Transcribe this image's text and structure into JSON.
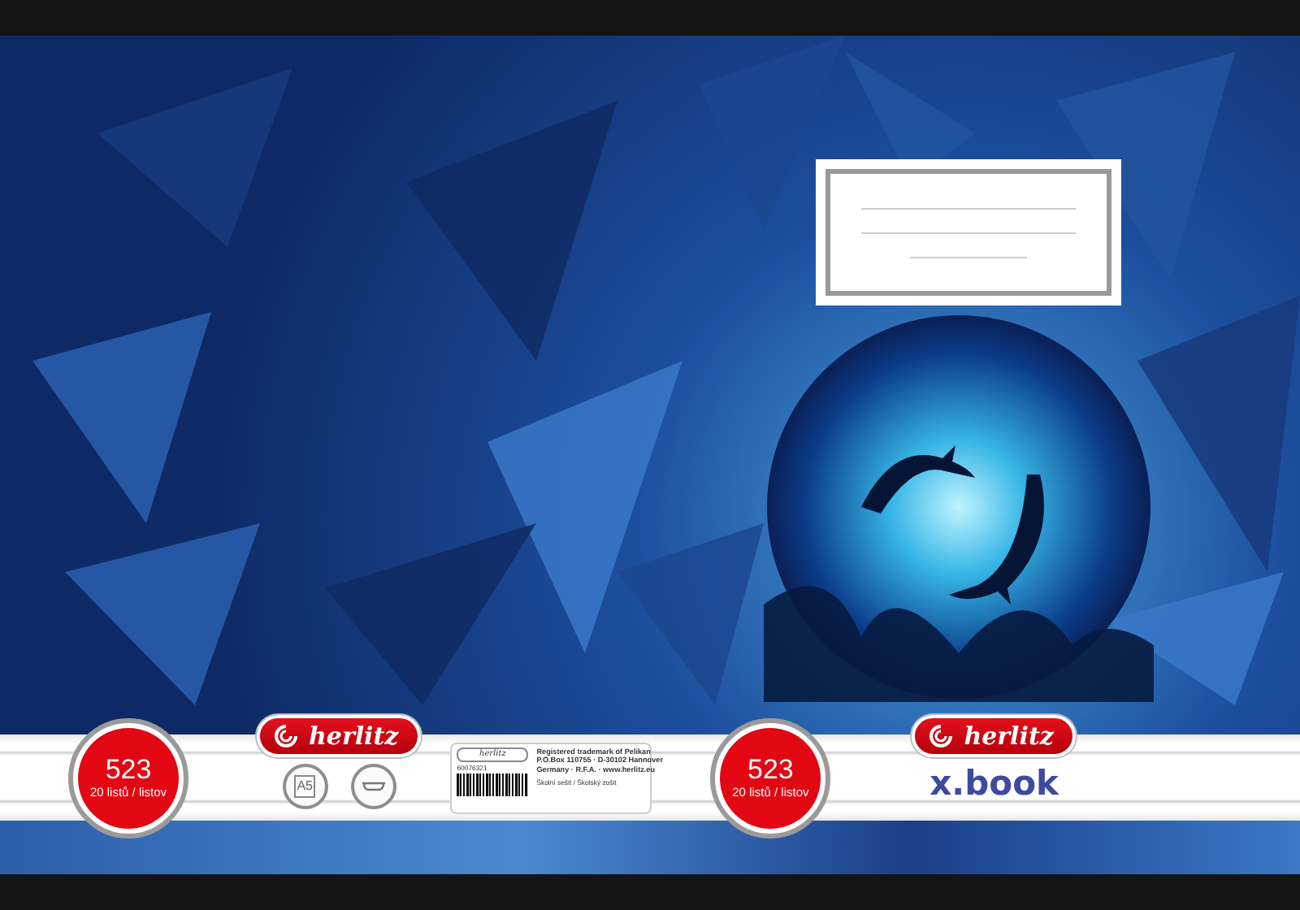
{
  "cover": {
    "band": {
      "left_badge": {
        "number": "523",
        "sheets": "20 listů / listov"
      },
      "left_logo": "herlitz",
      "format": "A5",
      "imprint": {
        "lines": [
          "Registered trademark of Pelikan",
          "P.O.Box 110755 · D-30102 Hannover",
          "Germany · R.F.A. · www.herlitz.eu"
        ],
        "logo": "herlitz",
        "article": "60076321",
        "note": "Školní sešit / Školský zošit"
      },
      "right_badge": {
        "number": "523",
        "sheets": "20 listů / listov"
      },
      "right_logo": "herlitz",
      "title": "x.book"
    }
  }
}
